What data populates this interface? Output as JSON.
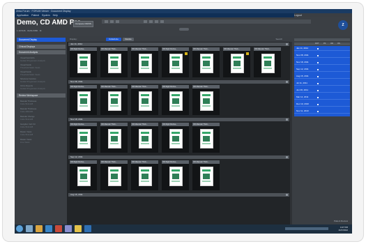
{
  "window": {
    "title": "Zeiss Forum · FORUM Viewer · Document Display"
  },
  "menu": {
    "items": [
      "Application",
      "Patient",
      "System",
      "Help"
    ],
    "right": "Logout"
  },
  "header": {
    "title": "Demo, CD AMD Pro...",
    "info": "1 107246  ·  01/01/1950  ·  M",
    "compare_label": "Compare OD/OS"
  },
  "left_panel": {
    "active_button": "Document Display",
    "sections": [
      {
        "label": "Clinical Displays",
        "items": []
      },
      {
        "label": "Document Analysis",
        "items": [
          {
            "label": "Visual Field HFA",
            "sub": "Guided Progression Analysis"
          },
          {
            "label": "Visual Fields",
            "sub": "Threshold Static Views"
          },
          {
            "label": "Visual Fields",
            "sub": "Threshold Static Views"
          },
          {
            "label": "Structure Function",
            "sub": "Guided Progression Analysis"
          },
          {
            "label": "Cirrus Reports",
            "sub": "Guided Progression Analysis"
          }
        ]
      },
      {
        "label": "Review Workspace",
        "items": [
          {
            "label": "Macular Thickness",
            "sub": "Cube 512x128"
          },
          {
            "label": "Macular Thickness",
            "sub": "Cube 200x200"
          },
          {
            "label": "Macular Change",
            "sub": "Cube 512x128"
          },
          {
            "label": "Ganglion Cell OU",
            "sub": "Cube 512x128"
          },
          {
            "label": "Raster Views",
            "sub": "Cube 512x128"
          },
          {
            "label": "Raster Views",
            "sub": "Line Views"
          }
        ]
      }
    ]
  },
  "toolbar": {
    "label": "Display:",
    "tabs": [
      "Cube/Line",
      "Device"
    ],
    "active_tab": "Cube/Line",
    "search": "Search"
  },
  "groups": [
    {
      "date": "Jan 11, 2012",
      "cards": [
        "OD Right Retina...",
        "OD Macular Thick...",
        "OD Macular Thick...",
        "OD Right Retina...",
        "OD Macular Thick...",
        "OD Macular Thick...",
        "OD Macular Thick..."
      ]
    },
    {
      "date": "Nov 28, 2011",
      "cards": [
        "OD Right Retina...",
        "OD Macular Thick...",
        "OD Macular Thick...",
        "OD Right Retina...",
        "OD Macular Thick..."
      ]
    },
    {
      "date": "Nov 18, 2011",
      "cards": [
        "OD Right Retina...",
        "OD Macular Thick...",
        "OD Macular Thick...",
        "OD Right Retina...",
        "OD Macular Thick..."
      ]
    },
    {
      "date": "Sep 12, 2011",
      "cards": [
        "OD Right Retina...",
        "OD Macular Thick...",
        "OD Macular Thick...",
        "OD Right Retina...",
        "OD Macular Thick..."
      ]
    },
    {
      "date": "Aug 15, 2011",
      "cards": []
    }
  ],
  "right_panel": {
    "columns": [
      "DOT",
      "PF",
      "OD",
      "OS"
    ],
    "dates": [
      "Jan 11, 2012",
      "Nov 28, 2011",
      "Nov 18, 2011",
      "Sep 12, 2011",
      "Aug 15, 2011",
      "Jul 11, 2011",
      "Jun 06, 2011",
      "Mar 14, 2011",
      "Dec 10, 2010",
      "Nov 11, 2010"
    ]
  },
  "taskbar": {
    "time": "4:47 PM",
    "date": "2/27/2012",
    "note": "Patient Review"
  }
}
